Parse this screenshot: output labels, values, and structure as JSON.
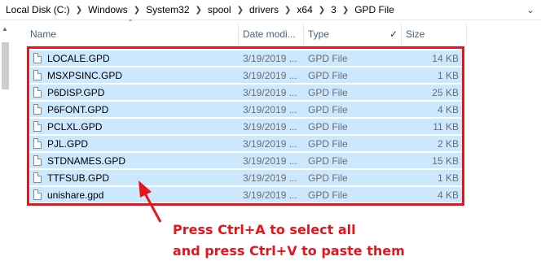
{
  "breadcrumb": {
    "items": [
      "Local Disk (C:)",
      "Windows",
      "System32",
      "spool",
      "drivers",
      "x64",
      "3",
      "GPD File"
    ],
    "separator_icon": "chevron-right-icon",
    "dropdown_icon": "chevron-down-icon"
  },
  "columns": {
    "name": "Name",
    "date": "Date modi...",
    "type": "Type",
    "size": "Size"
  },
  "files": [
    {
      "name": "LOCALE.GPD",
      "date": "3/19/2019 ...",
      "type": "GPD File",
      "size": "14 KB"
    },
    {
      "name": "MSXPSINC.GPD",
      "date": "3/19/2019 ...",
      "type": "GPD File",
      "size": "1 KB"
    },
    {
      "name": "P6DISP.GPD",
      "date": "3/19/2019 ...",
      "type": "GPD File",
      "size": "25 KB"
    },
    {
      "name": "P6FONT.GPD",
      "date": "3/19/2019 ...",
      "type": "GPD File",
      "size": "4 KB"
    },
    {
      "name": "PCLXL.GPD",
      "date": "3/19/2019 ...",
      "type": "GPD File",
      "size": "11 KB"
    },
    {
      "name": "PJL.GPD",
      "date": "3/19/2019 ...",
      "type": "GPD File",
      "size": "2 KB"
    },
    {
      "name": "STDNAMES.GPD",
      "date": "3/19/2019 ...",
      "type": "GPD File",
      "size": "15 KB"
    },
    {
      "name": "TTFSUB.GPD",
      "date": "3/19/2019 ...",
      "type": "GPD File",
      "size": "1 KB"
    },
    {
      "name": "unishare.gpd",
      "date": "3/19/2019 ...",
      "type": "GPD File",
      "size": "4 KB"
    }
  ],
  "annotation": {
    "line1": "Press Ctrl+A to select all",
    "line2": "and press Ctrl+V to paste them"
  },
  "colors": {
    "selection": "#cce8ff",
    "annotation_red": "#e8141c",
    "header_text": "#4c607a"
  }
}
